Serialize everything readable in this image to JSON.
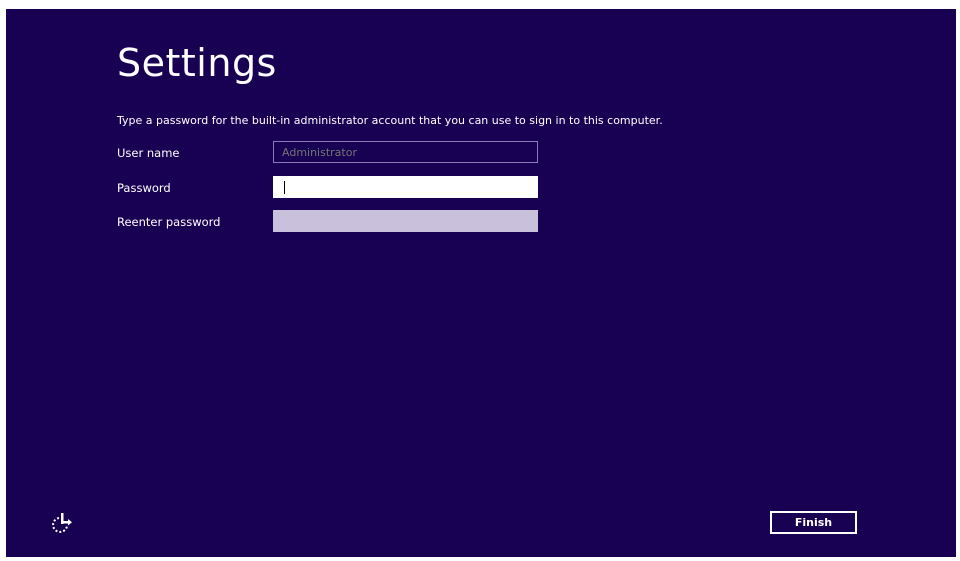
{
  "page": {
    "title": "Settings",
    "instruction": "Type a password for the built-in administrator account that you can use to sign in to this computer."
  },
  "form": {
    "username": {
      "label": "User name",
      "placeholder": "Administrator",
      "value": ""
    },
    "password": {
      "label": "Password",
      "value": ""
    },
    "reenter_password": {
      "label": "Reenter password",
      "value": ""
    }
  },
  "footer": {
    "ease_of_access_icon": "ease-of-access-icon",
    "finish_label": "Finish"
  },
  "colors": {
    "background": "#180052",
    "text": "#ffffff",
    "disabled_field_border": "#8a79b8",
    "disabled_field_fill": "#c9c0dc"
  }
}
